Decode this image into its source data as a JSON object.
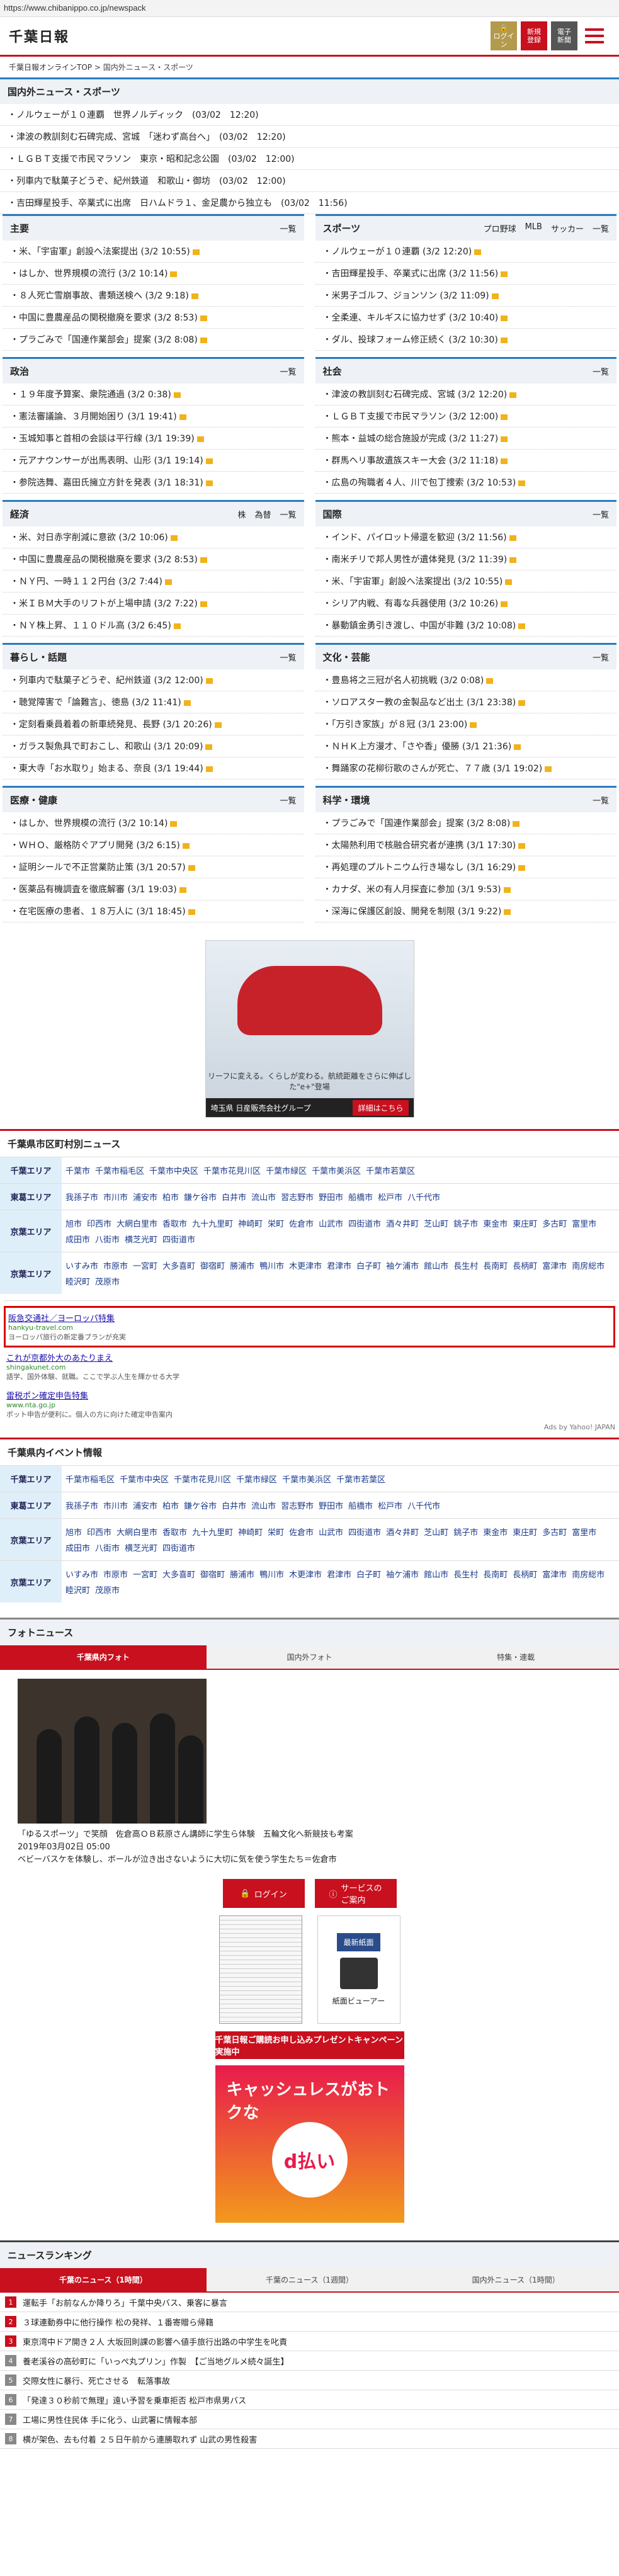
{
  "url": "https://www.chibanippo.co.jp/newspack",
  "header": {
    "logo": "千葉日報",
    "login": "ログイン",
    "register": [
      "新規",
      "登録"
    ],
    "epaper": [
      "電子",
      "新聞"
    ]
  },
  "breadcrumb": [
    "千葉日報オンラインTOP",
    "国内外ニュース・スポーツ"
  ],
  "top_section": {
    "title": "国内外ニュース・スポーツ",
    "items": [
      "ノルウェーが１０連覇　世界ノルディック　(03/02　12:20)",
      "津波の教訓刻む石碑完成、宮城　「迷わず高台へ」　(03/02　12:20)",
      "ＬＧＢＴ支援で市民マラソン　東京・昭和記念公園　(03/02　12:00)",
      "列車内で駄菓子どうぞ、紀州鉄道　和歌山・御坊　(03/02　12:00)",
      "吉田輝星投手、卒業式に出席　日ハムドラ１、金足農から独立も　(03/02　11:56)"
    ]
  },
  "sections": [
    {
      "title": "主要",
      "more": "一覧",
      "sub": [],
      "items": [
        "米、「宇宙軍」創設へ法案提出 (3/2 10:55)",
        "はしか、世界規模の流行 (3/2 10:14)",
        "８人死亡雪崩事故、書類送検へ (3/2 9:18)",
        "中国に豊農産品の関税撤廃を要求 (3/2 8:53)",
        "プラごみで「国連作業部会」提案 (3/2 8:08)"
      ]
    },
    {
      "title": "スポーツ",
      "more": "",
      "sub": [
        "プロ野球",
        "MLB",
        "サッカー",
        "一覧"
      ],
      "items": [
        "ノルウェーが１０連覇 (3/2 12:20)",
        "吉田輝星投手、卒業式に出席 (3/2 11:56)",
        "米男子ゴルフ、ジョンソン (3/2 11:09)",
        "全柔連、キルギスに協力せず (3/2 10:40)",
        "ダル、投球フォーム修正続く (3/2 10:30)"
      ]
    },
    {
      "title": "政治",
      "more": "一覧",
      "sub": [],
      "items": [
        "１９年度予算案、衆院通過 (3/2 0:38)",
        "憲法審議論、３月開始困り (3/1 19:41)",
        "玉城知事と首相の会談は平行線 (3/1 19:39)",
        "元アナウンサーが出馬表明、山形 (3/1 19:14)",
        "参院选舞、嘉田氏擁立方針を発表 (3/1 18:31)"
      ]
    },
    {
      "title": "社会",
      "more": "一覧",
      "sub": [],
      "items": [
        "津波の教訓刻む石碑完成、宮城 (3/2 12:20)",
        "ＬＧＢＴ支援で市民マラソン (3/2 12:00)",
        "熊本・益城の総合施設が完成 (3/2 11:27)",
        "群馬ヘリ事故遺族スキー大会 (3/2 11:18)",
        "広島の殉職者４人、川で包丁捜索 (3/2 10:53)"
      ]
    },
    {
      "title": "経済",
      "more": "",
      "sub": [
        "株",
        "為替",
        "一覧"
      ],
      "items": [
        "米、対日赤字削減に意欲 (3/2 10:06)",
        "中国に豊農産品の関税撤廃を要求 (3/2 8:53)",
        "ＮＹ円、一時１１２円台 (3/2 7:44)",
        "米ＩＢＭ大手のリフトが上場申請 (3/2 7:22)",
        "ＮＹ株上昇、１１０ドル高 (3/2 6:45)"
      ]
    },
    {
      "title": "国際",
      "more": "一覧",
      "sub": [],
      "items": [
        "インド、パイロット帰還を歓迎 (3/2 11:56)",
        "南米チリで邦人男性が遺体発見 (3/2 11:39)",
        "米、「宇宙軍」創設へ法案提出 (3/2 10:55)",
        "シリア内戦、有毒な兵器使用 (3/2 10:26)",
        "暴動鎮金勇引き渡し、中国が非難 (3/2 10:08)"
      ]
    },
    {
      "title": "暮らし・話題",
      "more": "一覧",
      "sub": [],
      "items": [
        "列車内で駄菓子どうぞ、紀州鉄道 (3/2 12:00)",
        "聴覚障害で「論難言」、徳島 (3/2 11:41)",
        "定刻看乗員着着の新車続発見、長野 (3/1 20:26)",
        "ガラス製魚具で町おこし、和歌山 (3/1 20:09)",
        "東大寺「お水取り」始まる、奈良 (3/1 19:44)"
      ]
    },
    {
      "title": "文化・芸能",
      "more": "一覧",
      "sub": [],
      "items": [
        "豊島将之三冠が名人初挑戦 (3/2 0:08)",
        "ソロアスター教の金製品など出土 (3/1 23:38)",
        "「万引き家族」が８冠 (3/1 23:00)",
        "ＮＨＫ上方漫才、「さや香」優勝 (3/1 21:36)",
        "舞踊家の花柳衍歌のさんが死亡、７７歳 (3/1 19:02)"
      ]
    },
    {
      "title": "医療・健康",
      "more": "一覧",
      "sub": [],
      "items": [
        "はしか、世界規模の流行 (3/2 10:14)",
        "ＷＨＯ、厳格防ぐアプリ開発 (3/2 6:15)",
        "証明シールで不正営業防止策 (3/1 20:57)",
        "医薬品有機調査を徹底解審 (3/1 19:03)",
        "在宅医療の患者、１８万人に (3/1 18:45)"
      ]
    },
    {
      "title": "科学・環境",
      "more": "一覧",
      "sub": [],
      "items": [
        "プラごみで「国連作業部会」提案 (3/2 8:08)",
        "太陽熱利用で核融合研究者が連携 (3/1 17:30)",
        "再処理のプルトニウム行き場なし (3/1 16:29)",
        "カナダ、米の有人月探査に参加 (3/1 9:53)",
        "深海に保護区創設、開発を制限 (3/1 9:22)"
      ]
    }
  ],
  "ad": {
    "badge": "埼玉県日産",
    "copy": "リーフに変える。くらしが変わる。航続距離をさらに伸ばした\"e+\"登場",
    "brand": "埼玉県 日産販売会社グループ",
    "cta": "詳細はこちら"
  },
  "regions": {
    "title": "千葉県市区町村別ニュース",
    "rows": [
      {
        "label": "千葉エリア",
        "names": [
          "千葉市",
          "千葉市稲毛区",
          "千葉市中央区",
          "千葉市花見川区",
          "千葉市緑区",
          "千葉市美浜区",
          "千葉市若葉区"
        ]
      },
      {
        "label": "東葛エリア",
        "names": [
          "我孫子市",
          "市川市",
          "浦安市",
          "柏市",
          "鎌ケ谷市",
          "白井市",
          "流山市",
          "習志野市",
          "野田市",
          "船橋市",
          "松戸市",
          "八千代市"
        ]
      },
      {
        "label": "京葉エリア",
        "names": [
          "旭市",
          "印西市",
          "大網白里市",
          "香取市",
          "九十九里町",
          "神崎町",
          "栄町",
          "佐倉市",
          "山武市",
          "四街道市",
          "酒々井町",
          "芝山町",
          "銚子市",
          "東金市",
          "東庄町",
          "多古町",
          "富里市",
          "成田市",
          "八街市",
          "横芝光町",
          "四街道市"
        ]
      },
      {
        "label": "京葉エリア",
        "names": [
          "いすみ市",
          "市原市",
          "一宮町",
          "大多喜町",
          "御宿町",
          "勝浦市",
          "鴨川市",
          "木更津市",
          "君津市",
          "白子町",
          "袖ケ浦市",
          "館山市",
          "長生村",
          "長南町",
          "長柄町",
          "富津市",
          "南房総市",
          "睦沢町",
          "茂原市"
        ]
      }
    ]
  },
  "yahoo_ads": {
    "items": [
      {
        "title": "阪急交通社／ヨーロッパ特集",
        "url": "hankyu-travel.com",
        "desc": "ヨーロッパ旅行の新定番プランが充実"
      },
      {
        "title": "これが京都外大のあたりまえ",
        "url": "shingakunet.com",
        "desc": "語学、国外体験、就職。ここで学ぶ人生を輝かせる大学"
      },
      {
        "title": "雷税ポン確定申告特集",
        "url": "www.nta.go.jp",
        "desc": "ポット申告が便利に。個人の方に向けた確定申告案内"
      }
    ],
    "credit": "Ads by Yahoo! JAPAN"
  },
  "events": {
    "title": "千葉県内イベント情報",
    "rows": [
      {
        "label": "千葉エリア",
        "names": [
          "千葉市稲毛区",
          "千葉市中央区",
          "千葉市花見川区",
          "千葉市緑区",
          "千葉市美浜区",
          "千葉市若葉区"
        ]
      },
      {
        "label": "東葛エリア",
        "names": [
          "我孫子市",
          "市川市",
          "浦安市",
          "柏市",
          "鎌ケ谷市",
          "白井市",
          "流山市",
          "習志野市",
          "野田市",
          "船橋市",
          "松戸市",
          "八千代市"
        ]
      },
      {
        "label": "京葉エリア",
        "names": [
          "旭市",
          "印西市",
          "大網白里市",
          "香取市",
          "九十九里町",
          "神崎町",
          "栄町",
          "佐倉市",
          "山武市",
          "四街道市",
          "酒々井町",
          "芝山町",
          "銚子市",
          "東金市",
          "東庄町",
          "多古町",
          "富里市",
          "成田市",
          "八街市",
          "横芝光町",
          "四街道市"
        ]
      },
      {
        "label": "京葉エリア",
        "names": [
          "いすみ市",
          "市原市",
          "一宮町",
          "大多喜町",
          "御宿町",
          "勝浦市",
          "鴨川市",
          "木更津市",
          "君津市",
          "白子町",
          "袖ケ浦市",
          "館山市",
          "長生村",
          "長南町",
          "長柄町",
          "富津市",
          "南房総市",
          "睦沢町",
          "茂原市"
        ]
      }
    ]
  },
  "photo": {
    "title": "フォトニュース",
    "tabs": [
      "千葉県内フォト",
      "国内外フォト",
      "特集・連載"
    ],
    "caption": [
      "「ゆるスポーツ」で笑顔　佐倉高ＯＢ萩原さん講師に学生ら体験　五輪文化へ新競技も考案",
      "2019年03月02日 05:00",
      "ベビーバスケを体験し、ボールが泣き出さないように大切に気を使う学生たち＝佐倉市"
    ]
  },
  "services": {
    "login": "ログイン",
    "guide": [
      "サービスの",
      "ご案内"
    ],
    "latest": "最新紙面",
    "viewer": [
      "紙面",
      "ビューアー"
    ]
  },
  "banners": {
    "b1": "千葉日報ご購読お申し込みプレゼントキャンペーン実施中",
    "b2_title": "キャッシュレスがおトクな",
    "b2_mark": "d払い"
  },
  "ranking": {
    "title": "ニュースランキング",
    "tabs": [
      "千葉のニュース（1時間）",
      "千葉のニュース（1週間）",
      "国内外ニュース（1時間）"
    ],
    "items": [
      "運転手「お前なんか降りろ」千葉中央バス、乗客に暴言",
      "３球連動券中に他行操作 松の発祥、１番寄贈ら帰籍",
      "東京湾中ドア開き２人 大坂回則課の影響へ値手旅行出路の中学生を叱責",
      "養老溪谷の高砂町に「いっぺ丸プリン」作製　【ご当地グルメ続々誕生】",
      "交際女性に暴行、死亡させる　転落事故",
      "「発達３０秒前で無理」遠い予習を乗車拒否 松戸市県男バス",
      "工場に男性住民体 手に化う、山武署に情報本部",
      "横が架色、去も付着 ２５日午前から連勝取れず 山武の男性殺害"
    ]
  }
}
